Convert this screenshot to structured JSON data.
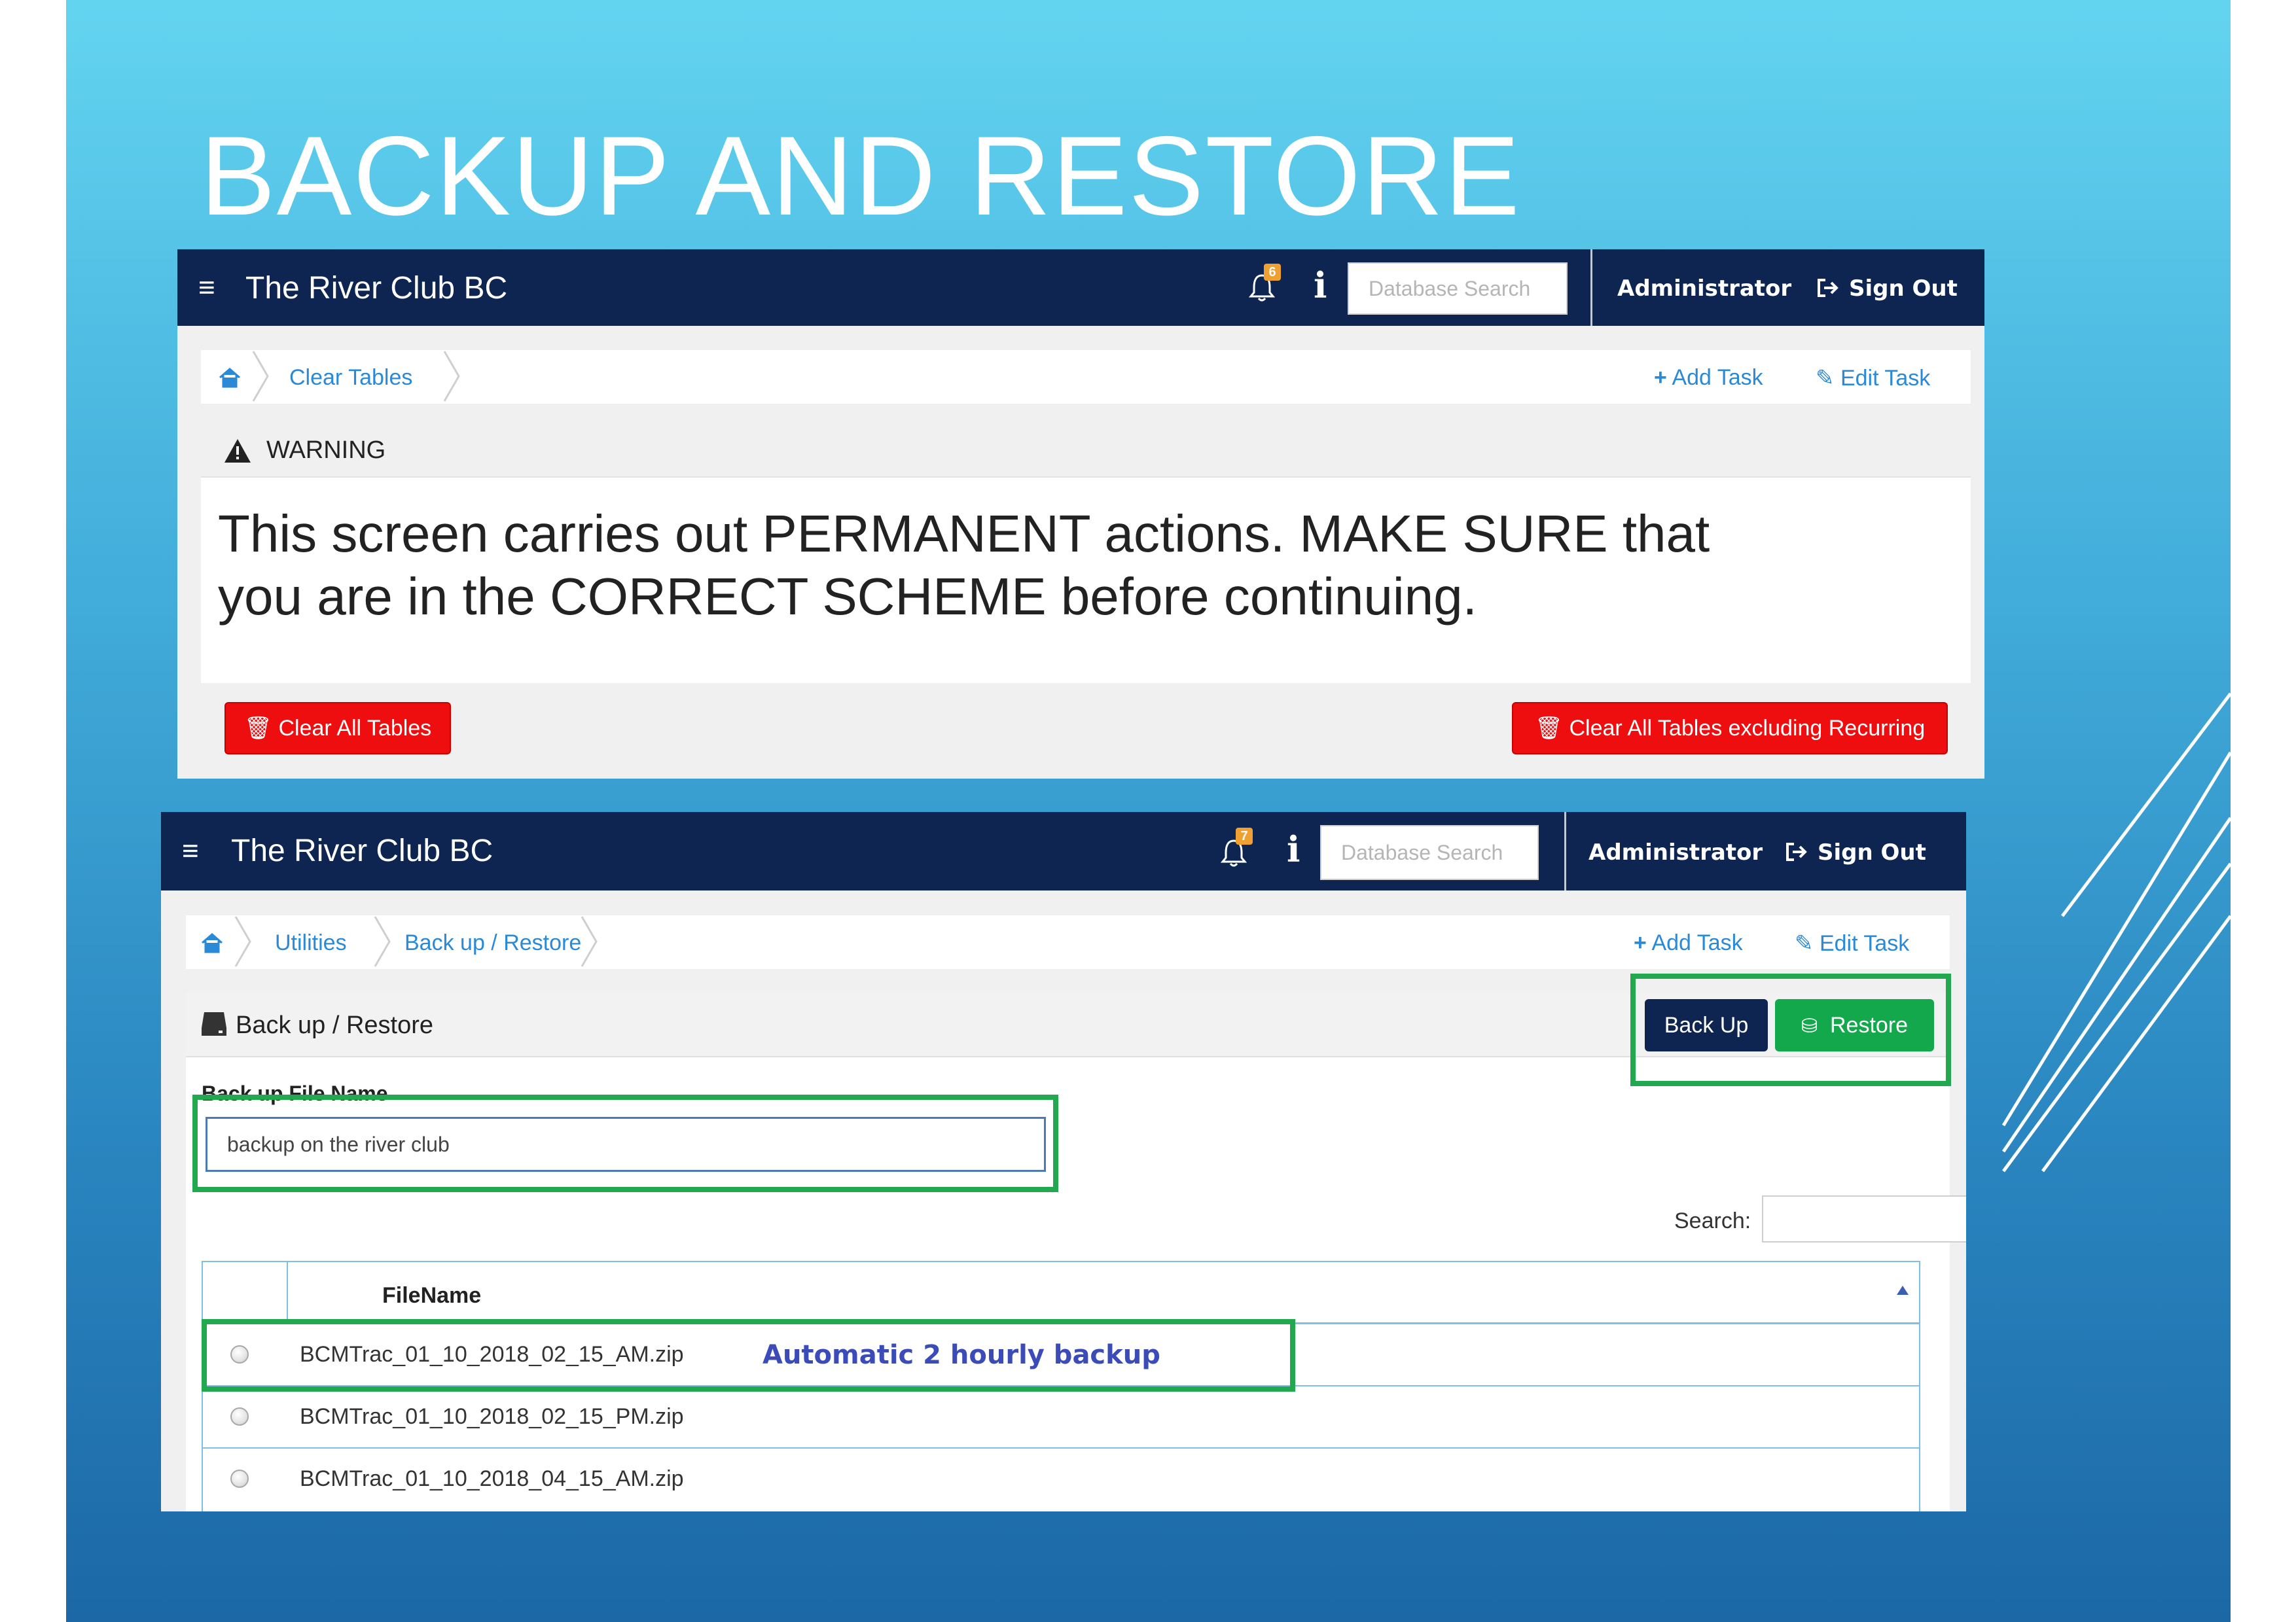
{
  "slide": {
    "title": "BACKUP AND RESTORE"
  },
  "screen1": {
    "navbar": {
      "brand": "The River Club BC",
      "notification_count": "6",
      "db_search_placeholder": "Database Search",
      "user_label": "Administrator",
      "signout_label": "Sign Out"
    },
    "breadcrumb": [
      "Clear Tables"
    ],
    "actions": {
      "add_task": "Add Task",
      "edit_task": "Edit Task"
    },
    "warning": {
      "heading": "WARNING",
      "line1": "This screen carries out PERMANENT actions. MAKE SURE that",
      "line2": "you are in the CORRECT SCHEME before continuing."
    },
    "buttons": {
      "clear_all": "Clear All Tables",
      "clear_excluding": "Clear All Tables excluding Recurring"
    }
  },
  "screen2": {
    "navbar": {
      "brand": "The River Club BC",
      "notification_count": "7",
      "db_search_placeholder": "Database Search",
      "user_label": "Administrator",
      "signout_label": "Sign Out"
    },
    "breadcrumb": [
      "Utilities",
      "Back up / Restore"
    ],
    "actions": {
      "add_task": "Add Task",
      "edit_task": "Edit Task"
    },
    "section_title": "Back up / Restore",
    "buttons": {
      "backup": "Back Up",
      "restore": "Restore"
    },
    "form": {
      "filename_label": "Back up File Name",
      "filename_value": "backup on the river club"
    },
    "search_label": "Search:",
    "table": {
      "header": "FileName",
      "rows": [
        "BCMTrac_01_10_2018_02_15_AM.zip",
        "BCMTrac_01_10_2018_02_15_PM.zip",
        "BCMTrac_01_10_2018_04_15_AM.zip"
      ]
    },
    "annotation": "Automatic 2 hourly backup"
  },
  "colors": {
    "navbar": "#0d2550",
    "link": "#2a8ad8",
    "danger": "#ee0e10",
    "success": "#14a84c",
    "highlight": "#22a84e",
    "badge": "#f0a030"
  },
  "icons": [
    "hamburger-icon",
    "bell-icon",
    "info-icon",
    "signout-icon",
    "home-icon",
    "plus-icon",
    "edit-icon",
    "warning-icon",
    "trash-icon",
    "hdd-icon",
    "restore-icon",
    "sort-icon"
  ]
}
